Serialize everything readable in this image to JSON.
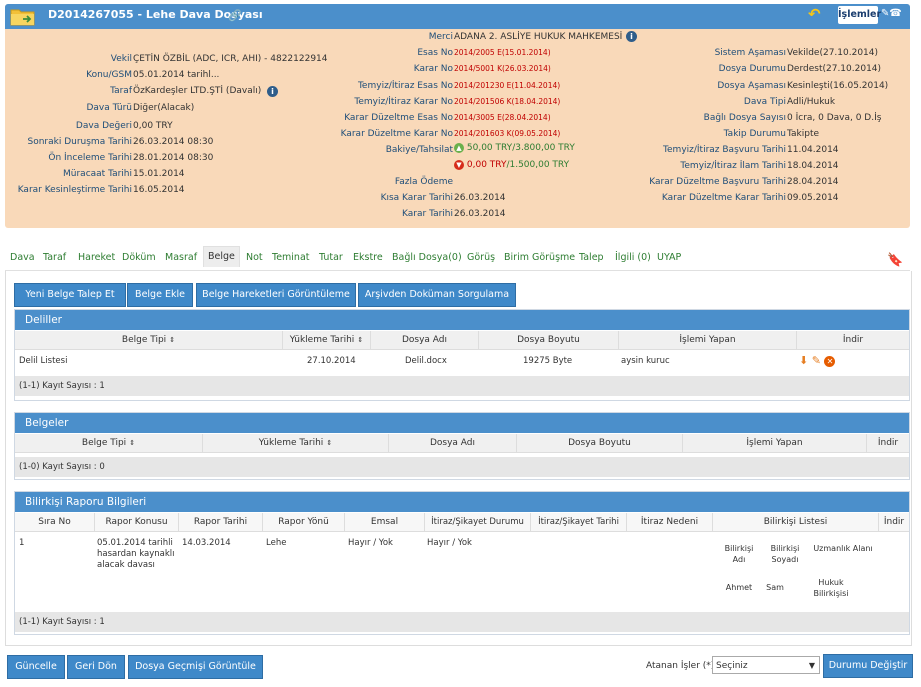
{
  "header": {
    "title": "D2014267055 - Lehe Dava Dosyası",
    "islemler_label": "İşlemler",
    "left": [
      {
        "label": "Vekil",
        "value": "ÇETİN ÖZBİL (ADC, ICR, AHI) - 4822122914"
      },
      {
        "label": "Konu/GSM",
        "value": "05.01.2014 tarihl..."
      },
      {
        "label": "Taraf",
        "value": "ÖzKardeşler LTD.ŞTİ  (Davalı)"
      },
      {
        "label": "Dava Türü",
        "value": "Diğer(Alacak)"
      },
      {
        "label": "Dava Değeri",
        "value": "0,00 TRY"
      },
      {
        "label": "Sonraki Duruşma Tarihi",
        "value": "26.03.2014 08:30"
      },
      {
        "label": "Ön İnceleme Tarihi",
        "value": "28.01.2014 08:30"
      },
      {
        "label": "Müracaat Tarihi",
        "value": "15.01.2014"
      },
      {
        "label": "Karar Kesinleştirme Tarihi",
        "value": "16.05.2014"
      }
    ],
    "middle": [
      {
        "label": "Merci",
        "value": "ADANA 2. ASLİYE HUKUK MAHKEMESİ"
      },
      {
        "label": "Esas No",
        "value": "2014/2005 E(15.01.2014)"
      },
      {
        "label": "Karar No",
        "value": "2014/5001 K(26.03.2014)"
      },
      {
        "label": "Temyiz/İtiraz Esas No",
        "value": "2014/201230 E(11.04.2014)"
      },
      {
        "label": "Temyiz/İtiraz Karar No",
        "value": "2014/201506 K(18.04.2014)"
      },
      {
        "label": "Karar Düzeltme Esas No",
        "value": "2014/3005 E(28.04.2014)"
      },
      {
        "label": "Karar Düzeltme Karar No",
        "value": "2014/201603 K(09.05.2014)"
      },
      {
        "label": "Bakiye/Tahsilat",
        "value1": "50,00 TRY",
        "value2": "/3.800,00 TRY",
        "value3": "0,00 TRY",
        "value4": "/1.500,00 TRY"
      },
      {
        "label": "Fazla Ödeme",
        "value": ""
      },
      {
        "label": "Kısa Karar Tarihi",
        "value": "26.03.2014"
      },
      {
        "label": "Karar Tarihi",
        "value": "26.03.2014"
      }
    ],
    "right": [
      {
        "label": "Sistem Aşaması",
        "value": "Vekilde(27.10.2014)"
      },
      {
        "label": "Dosya Durumu",
        "value": "Derdest(27.10.2014)"
      },
      {
        "label": "Dosya Aşaması",
        "value": "Kesinleşti(16.05.2014)"
      },
      {
        "label": "Dava Tipi",
        "value": "Adli/Hukuk"
      },
      {
        "label": "Bağlı Dosya Sayısı",
        "value": "0 İcra, 0 Dava, 0 D.İş"
      },
      {
        "label": "Takip Durumu",
        "value": "Takipte"
      },
      {
        "label": "Temyiz/İtiraz Başvuru Tarihi",
        "value": "11.04.2014"
      },
      {
        "label": "Temyiz/İtiraz İlam Tarihi",
        "value": "18.04.2014"
      },
      {
        "label": "Karar Düzeltme Başvuru Tarihi",
        "value": "28.04.2014"
      },
      {
        "label": "Karar Düzeltme Karar Tarihi",
        "value": "09.05.2014"
      }
    ]
  },
  "tabs": [
    "Dava",
    "Taraf",
    "Hareket",
    "Döküm",
    "Masraf",
    "Belge",
    "Not",
    "Teminat",
    "Tutar",
    "Ekstre",
    "Bağlı Dosya(0)",
    "Görüş",
    "Birim Görüşme",
    "Talep",
    "İlgili (0)",
    "UYAP"
  ],
  "active_tab": "Belge",
  "toolbar": [
    "Yeni Belge Talep Et",
    "Belge Ekle",
    "Belge Hareketleri Görüntüleme",
    "Arşivden Doküman Sorgulama"
  ],
  "deliller": {
    "title": "Deliller",
    "columns": [
      "Belge Tipi",
      "Yükleme Tarihi",
      "Dosya Adı",
      "Dosya Boyutu",
      "İşlemi Yapan",
      "İndir"
    ],
    "rows": [
      [
        "Delil Listesi",
        "27.10.2014",
        "Delil.docx",
        "19275 Byte",
        "aysin kuruc"
      ]
    ],
    "footer": "(1-1) Kayıt Sayısı : 1"
  },
  "belgeler": {
    "title": "Belgeler",
    "columns": [
      "Belge Tipi",
      "Yükleme Tarihi",
      "Dosya Adı",
      "Dosya Boyutu",
      "İşlemi Yapan",
      "İndir"
    ],
    "footer": "(1-0) Kayıt Sayısı : 0"
  },
  "bilirkisi": {
    "title": "Bilirkişi Raporu Bilgileri",
    "columns": [
      "Sıra No",
      "Rapor Konusu",
      "Rapor Tarihi",
      "Rapor Yönü",
      "Emsal",
      "İtiraz/Şikayet Durumu",
      "İtiraz/Şikayet Tarihi",
      "İtiraz Nedeni",
      "Bilirkişi Listesi",
      "İndir"
    ],
    "row": {
      "sira": "1",
      "konu": "05.01.2014 tarihli hasardan kaynaklı alacak davası",
      "tarih": "14.03.2014",
      "yon": "Lehe",
      "emsal": "Hayır / Yok",
      "itiraz": "Hayır / Yok"
    },
    "sub_headers": [
      "Bilirkişi Adı",
      "Bilirkişi Soyadı",
      "Uzmanlık Alanı"
    ],
    "sub_row": [
      "Ahmet",
      "Sam",
      "Hukuk Bilirkişisi"
    ],
    "footer": "(1-1) Kayıt Sayısı : 1"
  },
  "bottom": {
    "buttons": [
      "Güncelle",
      "Geri Dön",
      "Dosya Geçmişi Görüntüle"
    ],
    "atanan_label": "Atanan İşler (*)",
    "select_value": "Seçiniz",
    "durum_button": "Durumu Değiştir"
  }
}
